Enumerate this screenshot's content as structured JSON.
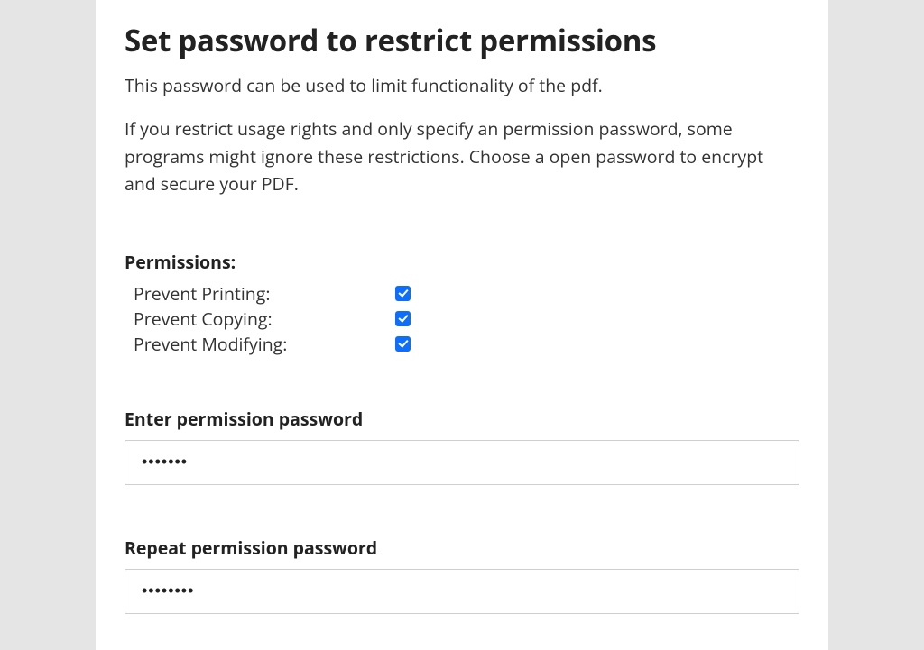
{
  "title": "Set password to restrict permissions",
  "desc": "This password can be used to limit functionality of the pdf.",
  "note": "If you restrict usage rights and only specify an permission password, some programs might ignore these restrictions. Choose a open password to encrypt and secure your PDF.",
  "permissions": {
    "heading": "Permissions:",
    "prevent_printing": {
      "label": "Prevent Printing:",
      "checked": true
    },
    "prevent_copying": {
      "label": "Prevent Copying:",
      "checked": true
    },
    "prevent_modifying": {
      "label": "Prevent Modifying:",
      "checked": true
    }
  },
  "enter": {
    "label": "Enter permission password",
    "value": "•••••••"
  },
  "repeat": {
    "label": "Repeat permission password",
    "value": "••••••••"
  }
}
